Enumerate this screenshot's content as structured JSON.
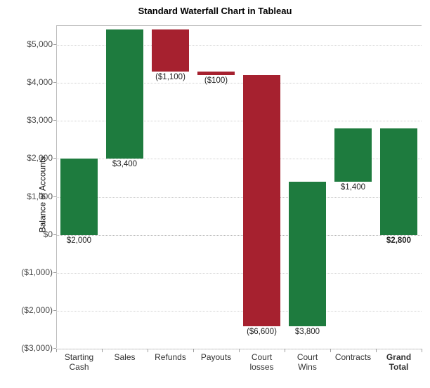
{
  "chart_data": {
    "type": "bar",
    "subtype": "waterfall",
    "title": "Standard Waterfall Chart in Tableau",
    "ylabel": "Balance of Accounts",
    "xlabel": "",
    "ylim": [
      -3000,
      5500
    ],
    "y_ticks": [
      -3000,
      -2000,
      -1000,
      0,
      1000,
      2000,
      3000,
      4000,
      5000
    ],
    "y_tick_labels": [
      "($3,000)",
      "($2,000)",
      "($1,000)",
      "$0",
      "$1,000",
      "$2,000",
      "$3,000",
      "$4,000",
      "$5,000"
    ],
    "categories": [
      "Starting Cash",
      "Sales",
      "Refunds",
      "Payouts",
      "Court losses",
      "Court Wins",
      "Contracts",
      "Grand Total"
    ],
    "values": [
      2000,
      3400,
      -1100,
      -100,
      -6600,
      3800,
      1400,
      2800
    ],
    "data_labels": [
      "$2,000",
      "$3,400",
      "($1,100)",
      "($100)",
      "($6,600)",
      "$3,800",
      "$1,400",
      "$2,800"
    ],
    "colors": {
      "positive": "#1e7b3e",
      "negative": "#a6212f"
    },
    "bold_categories": [
      "Grand Total"
    ],
    "bars": [
      {
        "label": "Starting Cash",
        "from": 0,
        "to": 2000,
        "value": 2000,
        "display": "$2,000",
        "kind": "pos",
        "label_pos": "below"
      },
      {
        "label": "Sales",
        "from": 2000,
        "to": 5400,
        "value": 3400,
        "display": "$3,400",
        "kind": "pos",
        "label_pos": "below"
      },
      {
        "label": "Refunds",
        "from": 5400,
        "to": 4300,
        "value": -1100,
        "display": "($1,100)",
        "kind": "neg",
        "label_pos": "below"
      },
      {
        "label": "Payouts",
        "from": 4300,
        "to": 4200,
        "value": -100,
        "display": "($100)",
        "kind": "neg",
        "label_pos": "below"
      },
      {
        "label": "Court losses",
        "from": 4200,
        "to": -2400,
        "value": -6600,
        "display": "($6,600)",
        "kind": "neg",
        "label_pos": "below"
      },
      {
        "label": "Court Wins",
        "from": -2400,
        "to": 1400,
        "value": 3800,
        "display": "$3,800",
        "kind": "pos",
        "label_pos": "below"
      },
      {
        "label": "Contracts",
        "from": 1400,
        "to": 2800,
        "value": 1400,
        "display": "$1,400",
        "kind": "pos",
        "label_pos": "below"
      },
      {
        "label": "Grand Total",
        "from": 0,
        "to": 2800,
        "value": 2800,
        "display": "$2,800",
        "kind": "pos",
        "label_pos": "below",
        "bold": true
      }
    ]
  }
}
